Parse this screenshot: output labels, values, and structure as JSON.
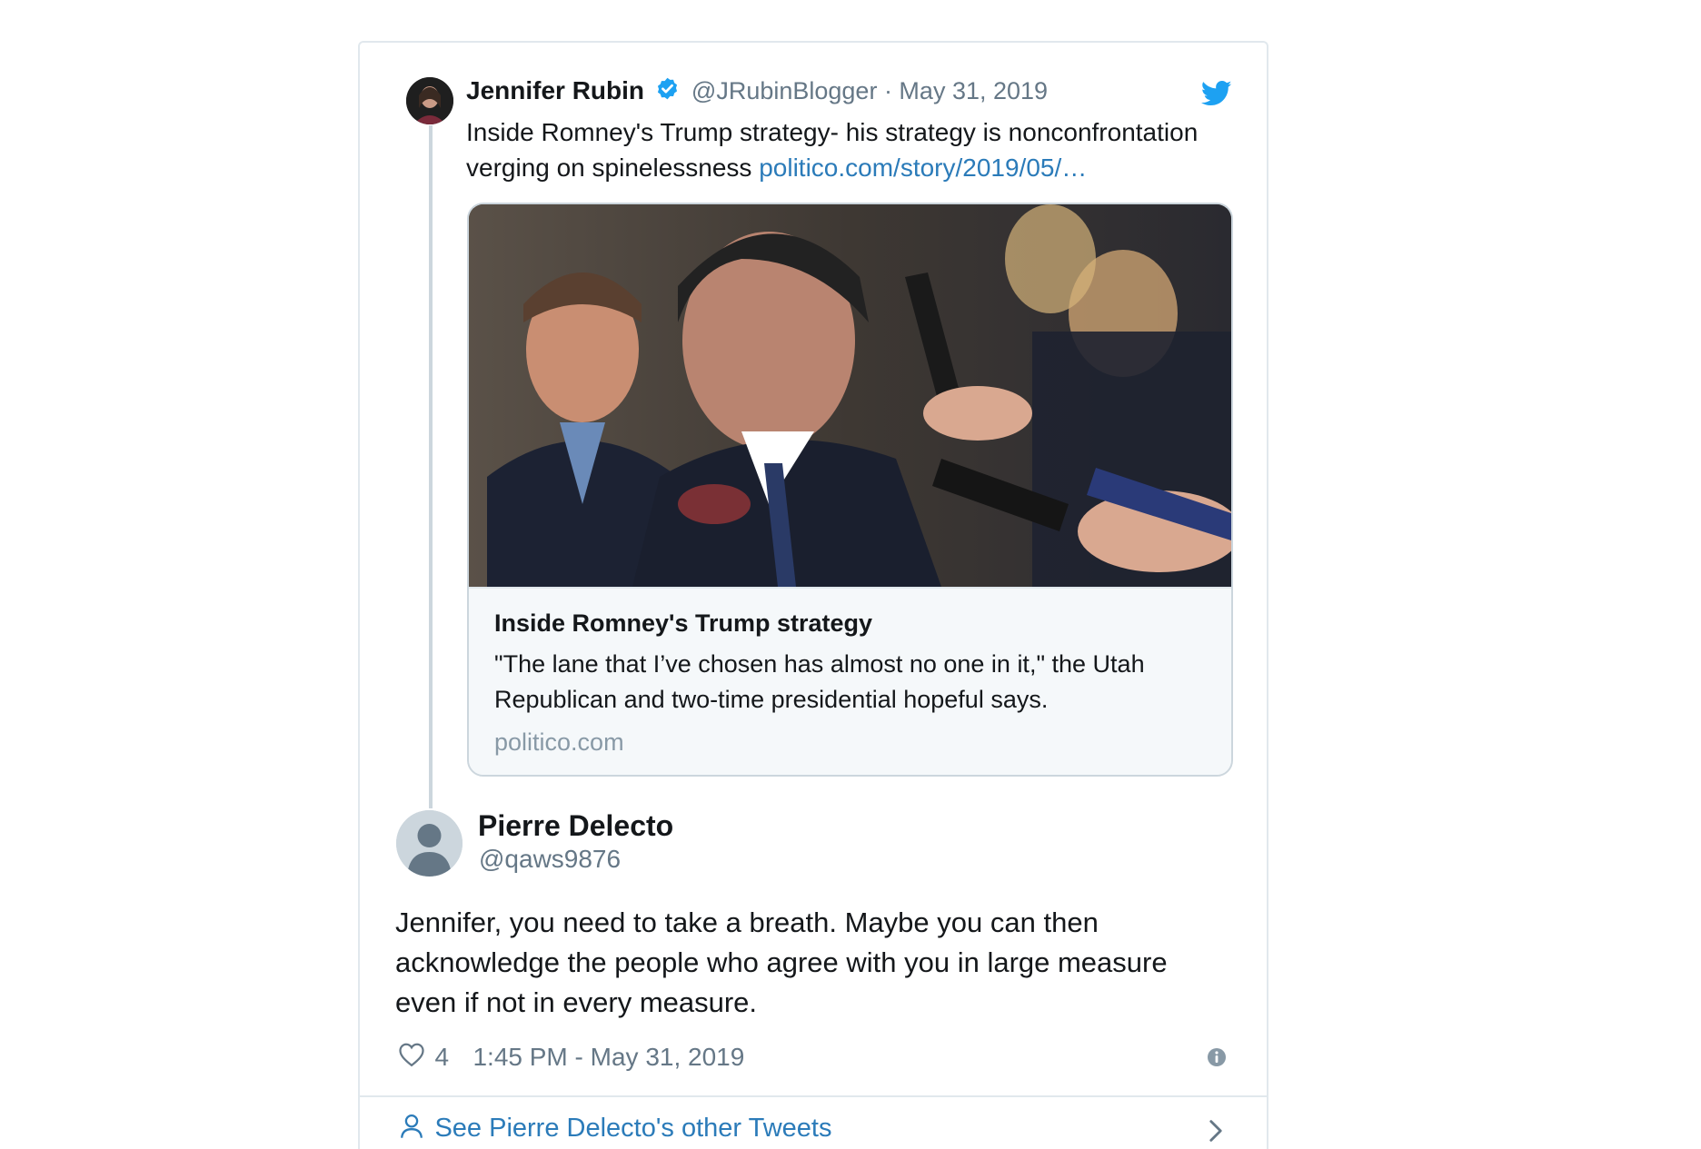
{
  "quoted_tweet": {
    "author_name": "Jennifer Rubin",
    "verified": true,
    "handle_and_date": "@JRubinBlogger · May 31, 2019",
    "text": "Inside Romney's Trump strategy- his strategy is nonconfrontation verging on spinelessness",
    "link": "politico.com/story/2019/05/…",
    "card": {
      "title": "Inside Romney's Trump strategy",
      "description": "\"The lane that I’ve chosen has almost no one in it,\" the Utah Republican and two-time presidential hopeful says.",
      "domain": "politico.com"
    }
  },
  "reply_tweet": {
    "author_name": "Pierre Delecto",
    "handle": "@qaws9876",
    "text": "Jennifer, you need to take a breath. Maybe you can then acknowledge the people who agree with you in large measure even if not in every measure.",
    "likes": "4",
    "timestamp": "1:45 PM - May 31, 2019"
  },
  "footer": {
    "label": "See Pierre Delecto's other Tweets"
  },
  "colors": {
    "link": "#2b7bb9",
    "twitter_blue": "#1da1f2",
    "muted": "#657786",
    "border": "#e1e8ed"
  },
  "icons": [
    "twitter-bird-icon",
    "verified-badge-icon",
    "heart-icon",
    "info-icon",
    "person-icon",
    "chevron-right-icon"
  ]
}
